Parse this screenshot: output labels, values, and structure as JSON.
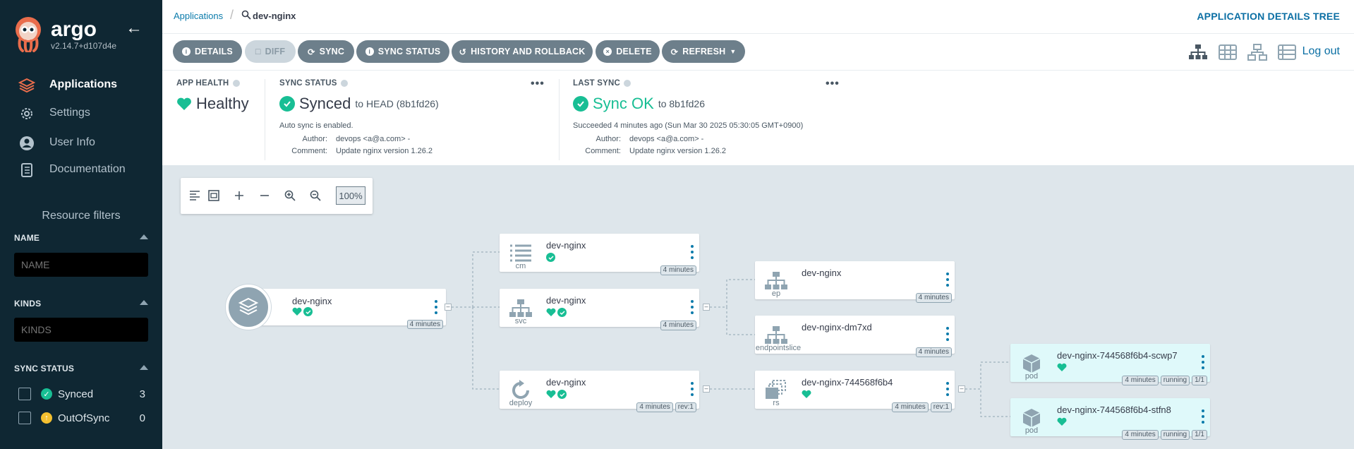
{
  "sidebar": {
    "brand": "argo",
    "version": "v2.14.7+d107d4e",
    "nav": [
      {
        "label": "Applications",
        "icon": "layers-icon",
        "active": true
      },
      {
        "label": "Settings",
        "icon": "gear-icon"
      },
      {
        "label": "User Info",
        "icon": "user-icon"
      },
      {
        "label": "Documentation",
        "icon": "book-icon"
      }
    ],
    "resource_filters": {
      "title": "Resource filters",
      "name_label": "NAME",
      "name_placeholder": "NAME",
      "kinds_label": "KINDS",
      "kinds_placeholder": "KINDS",
      "sync_status_label": "SYNC STATUS",
      "sync_items": [
        {
          "label": "Synced",
          "count": "3",
          "color": "#18be94"
        },
        {
          "label": "OutOfSync",
          "count": "0",
          "color": "#f4c030"
        }
      ]
    }
  },
  "topbar": {
    "breadcrumb_root": "Applications",
    "app_name": "dev-nginx",
    "page_title": "APPLICATION DETAILS TREE"
  },
  "toolbar": {
    "buttons": [
      {
        "label": "DETAILS",
        "icon": "info-icon"
      },
      {
        "label": "DIFF",
        "icon": "file-icon",
        "disabled": true
      },
      {
        "label": "SYNC",
        "icon": "sync-icon"
      },
      {
        "label": "SYNC STATUS",
        "icon": "info-icon"
      },
      {
        "label": "HISTORY AND ROLLBACK",
        "icon": "history-icon"
      },
      {
        "label": "DELETE",
        "icon": "delete-icon"
      },
      {
        "label": "REFRESH",
        "icon": "refresh-icon"
      }
    ],
    "logout": "Log out"
  },
  "status": {
    "app_health": {
      "label": "APP HEALTH",
      "value": "Healthy"
    },
    "sync_status": {
      "label": "SYNC STATUS",
      "value": "Synced",
      "target": "to HEAD (8b1fd26)",
      "auto_sync": "Auto sync is enabled.",
      "author_key": "Author:",
      "author": "devops <a@a.com> -",
      "comment_key": "Comment:",
      "comment": "Update nginx version 1.26.2"
    },
    "last_sync": {
      "label": "LAST SYNC",
      "value": "Sync OK",
      "target": "to 8b1fd26",
      "succeeded": "Succeeded 4 minutes ago (Sun Mar 30 2025 05:30:05 GMT+0900)",
      "author_key": "Author:",
      "author": "devops <a@a.com> -",
      "comment_key": "Comment:",
      "comment": "Update nginx version 1.26.2"
    }
  },
  "graph": {
    "zoom": "100%",
    "app": {
      "name": "dev-nginx",
      "age": "4 minutes"
    },
    "nodes": {
      "cm": {
        "kind": "cm",
        "name": "dev-nginx",
        "tags": [
          "4 minutes"
        ]
      },
      "svc": {
        "kind": "svc",
        "name": "dev-nginx",
        "tags": [
          "4 minutes"
        ]
      },
      "deploy": {
        "kind": "deploy",
        "name": "dev-nginx",
        "tags": [
          "4 minutes",
          "rev:1"
        ]
      },
      "ep": {
        "kind": "ep",
        "name": "dev-nginx",
        "tags": [
          "4 minutes"
        ]
      },
      "eps": {
        "kind": "endpointslice",
        "name": "dev-nginx-dm7xd",
        "tags": [
          "4 minutes"
        ]
      },
      "rs": {
        "kind": "rs",
        "name": "dev-nginx-744568f6b4",
        "tags": [
          "4 minutes",
          "rev:1"
        ]
      },
      "pod1": {
        "kind": "pod",
        "name": "dev-nginx-744568f6b4-scwp7",
        "tags": [
          "4 minutes",
          "running",
          "1/1"
        ]
      },
      "pod2": {
        "kind": "pod",
        "name": "dev-nginx-744568f6b4-stfn8",
        "tags": [
          "4 minutes",
          "running",
          "1/1"
        ]
      }
    }
  }
}
